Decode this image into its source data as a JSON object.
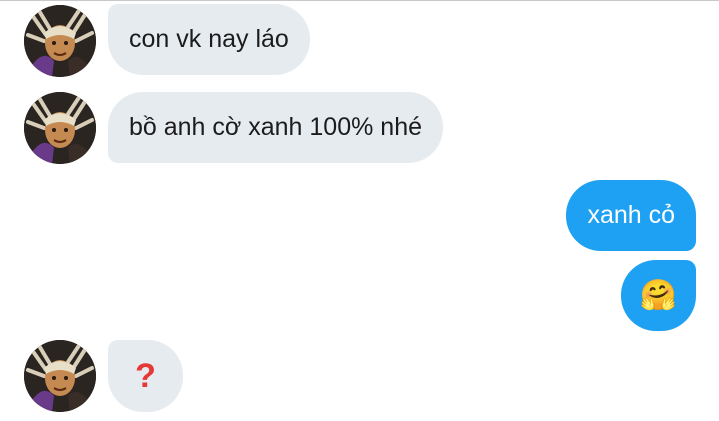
{
  "messages": [
    {
      "direction": "incoming",
      "text": "con vk nay láo",
      "avatar_icon": "user-avatar-icon"
    },
    {
      "direction": "incoming",
      "text": "bồ anh cờ xanh 100% nhé",
      "avatar_icon": "user-avatar-icon"
    },
    {
      "direction": "outgoing",
      "text": "xanh cỏ"
    },
    {
      "direction": "outgoing",
      "emoji": "🤗",
      "emoji_name": "hugging-face-emoji"
    },
    {
      "direction": "incoming",
      "emoji": "❓",
      "emoji_name": "red-question-mark-emoji",
      "avatar_icon": "user-avatar-icon"
    }
  ],
  "colors": {
    "incoming_bubble": "#e6ebf0",
    "outgoing_bubble": "#1ea1f2",
    "incoming_text": "#1c1c1c",
    "outgoing_text": "#ffffff",
    "question_mark": "#e53935"
  }
}
